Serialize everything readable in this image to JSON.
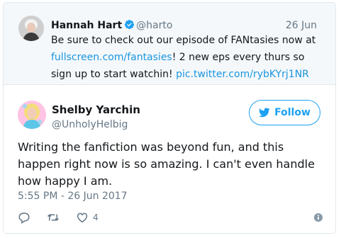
{
  "quoted_tweet": {
    "author_name": "Hannah Hart",
    "handle": "@harto",
    "date": "26 Jun",
    "text_line1": "Be sure to check out our episode of FANtasies now at",
    "text_line2_link": "fullscreen.com/fantasies",
    "text_line2_rest": "! 2 new eps every thurs so",
    "text_line3": "sign up to start watchin! ",
    "text_line3_link": "pic.twitter.com/rybKYrj1NR"
  },
  "tweet": {
    "author_name": "Shelby Yarchin",
    "handle": "@UnholyHelbig",
    "follow_label": "Follow",
    "text": "Writing the fanfiction was beyond fun, and this happen right now is so amazing. I can't even handle how happy I am.",
    "timestamp": "5:55 PM - 26 Jun 2017",
    "like_count": "4"
  },
  "colors": {
    "accent": "#1da1f2",
    "link": "#1b95e0",
    "secondary_text": "#657786",
    "border": "#e1e8ed",
    "quoted_background": "#f5f8fa"
  },
  "icons": {
    "verified": "verified-badge-icon",
    "follow": "twitter-bird-icon",
    "reply": "reply-icon",
    "retweet": "retweet-icon",
    "like": "heart-icon",
    "info": "info-icon"
  }
}
